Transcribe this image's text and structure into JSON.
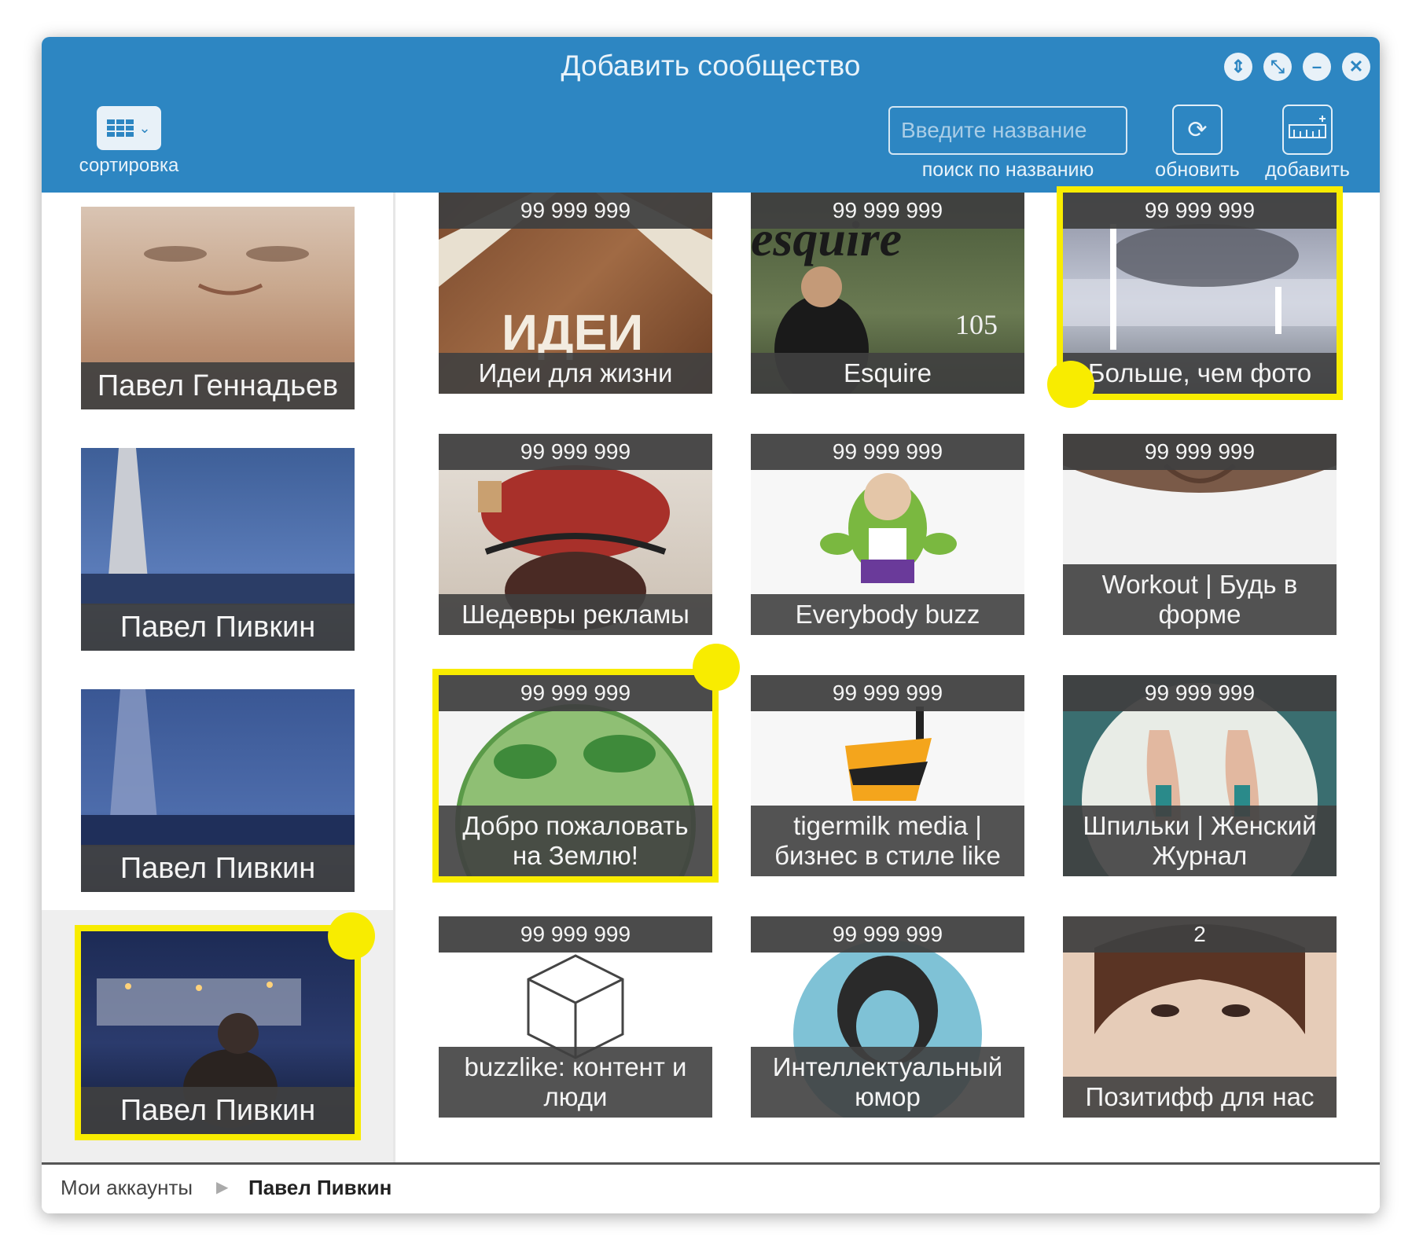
{
  "window": {
    "title": "Добавить сообщество"
  },
  "toolbar": {
    "sort_label": "сортировка",
    "search_placeholder": "Введите название",
    "search_label": "поиск по названию",
    "refresh_label": "обновить",
    "add_label": "добавить"
  },
  "accounts": [
    {
      "name": "Павел Геннадьев"
    },
    {
      "name": "Павел Пивкин"
    },
    {
      "name": "Павел Пивкин"
    },
    {
      "name": "Павел Пивкин"
    }
  ],
  "communities": [
    {
      "count": "99 999 999",
      "name": "Идеи для жизни"
    },
    {
      "count": "99 999 999",
      "name": "Esquire"
    },
    {
      "count": "99 999 999",
      "name": "Больше, чем фото"
    },
    {
      "count": "99 999 999",
      "name": "Шедевры рекламы"
    },
    {
      "count": "99 999 999",
      "name": "Everybody buzz"
    },
    {
      "count": "99 999 999",
      "name": "Workout | Будь в форме"
    },
    {
      "count": "99 999 999",
      "name": "Добро пожаловать на Землю!"
    },
    {
      "count": "99 999 999",
      "name": "tigermilk media | бизнес в стиле like"
    },
    {
      "count": "99 999 999",
      "name": "Шпильки | Женский Журнал"
    },
    {
      "count": "99 999 999",
      "name": "buzzlike: контент и люди"
    },
    {
      "count": "99 999 999",
      "name": "Интеллектуальный юмор"
    },
    {
      "count": "2",
      "name": "Позитифф для нас"
    }
  ],
  "tile_images": {
    "esquire_masthead": "esquire",
    "esquire_issue": "105"
  },
  "breadcrumb": {
    "root": "Мои аккаунты",
    "current": "Павел Пивкин"
  },
  "colors": {
    "header_blue": "#2d86c2",
    "selection_yellow": "#f8ec00",
    "label_dark": "#404040"
  }
}
